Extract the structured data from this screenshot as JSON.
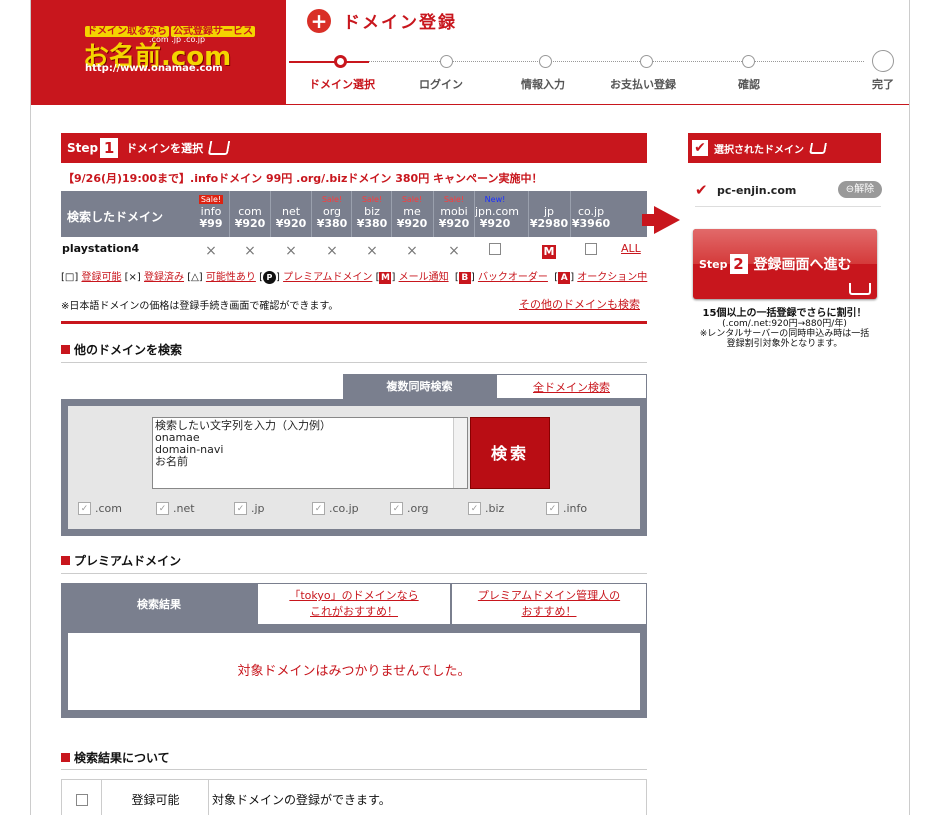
{
  "header": {
    "logo_tagline": "ドメイン取るなら",
    "logo_badge": "公式登録サービス",
    "logo_tlds": ".com .jp .co.jp",
    "logo_name": "お名前.com",
    "logo_url": "http://www.onamae.com",
    "page_title": "ドメイン登録",
    "steps": [
      "ドメイン選択",
      "ログイン",
      "情報入力",
      "お支払い登録",
      "確認",
      "完了"
    ],
    "current_step": 0
  },
  "step1": {
    "step_word": "Step",
    "step_num": "1",
    "title": "ドメインを選択",
    "campaign": "【9/26(月)19:00まで】.infoドメイン 99円 .org/.bizドメイン 380円 キャンペーン実施中！"
  },
  "domain_table": {
    "header_label": "検索したドメイン",
    "columns": [
      {
        "badge": "Sale!",
        "badge_type": "salebox",
        "tld": "info",
        "price": "¥99"
      },
      {
        "badge": "",
        "badge_type": "",
        "tld": "com",
        "price": "¥920"
      },
      {
        "badge": "",
        "badge_type": "",
        "tld": "net",
        "price": "¥920"
      },
      {
        "badge": "Sale!",
        "badge_type": "sale",
        "tld": "org",
        "price": "¥380"
      },
      {
        "badge": "Sale!",
        "badge_type": "sale",
        "tld": "biz",
        "price": "¥380"
      },
      {
        "badge": "Sale!",
        "badge_type": "sale",
        "tld": "me",
        "price": "¥920"
      },
      {
        "badge": "Sale!",
        "badge_type": "sale",
        "tld": "mobi",
        "price": "¥920"
      },
      {
        "badge": "New!",
        "badge_type": "new",
        "tld": "jpn.com",
        "price": "¥920"
      },
      {
        "badge": "",
        "badge_type": "",
        "tld": "jp",
        "price": "¥2980"
      },
      {
        "badge": "",
        "badge_type": "",
        "tld": "co.jp",
        "price": "¥3960"
      }
    ],
    "query": "playstation4",
    "status": [
      "×",
      "×",
      "×",
      "×",
      "×",
      "×",
      "×",
      "□",
      "M",
      "□"
    ],
    "all_link": "ALL"
  },
  "legend": {
    "available_sym": "[□]",
    "available": "登録可能",
    "taken_sym": "[×]",
    "taken": "登録済み",
    "maybe_sym": "[△]",
    "maybe": "可能性あり",
    "premium_sym": "P",
    "premium": "プレミアムドメイン",
    "mail_sym": "M",
    "mail": "メール通知",
    "backorder_sym": "B",
    "backorder": "バックオーダー",
    "auction_sym": "A",
    "auction": "オークション中"
  },
  "note": "※日本語ドメインの価格は登録手続き画面で確認ができます。",
  "other_search_link": "その他のドメインも検索",
  "other_search": {
    "title": "他のドメインを検索",
    "tab_active": "複数同時検索",
    "tab_inactive": "全ドメイン検索",
    "textarea": "検索したい文字列を入力（入力例）\nonamae\ndomain-navi\nお名前",
    "search_button": "検索",
    "tlds": [
      ".com",
      ".net",
      ".jp",
      ".co.jp",
      ".org",
      ".biz",
      ".info"
    ]
  },
  "premium": {
    "title": "プレミアムドメイン",
    "head1": "検索結果",
    "head2_line1": "「tokyo」のドメインなら",
    "head2_line2": "これがおすすめ！",
    "head3_line1": "プレミアムドメイン管理人の",
    "head3_line2": "おすすめ！",
    "empty": "対象ドメインはみつかりませんでした。"
  },
  "about": {
    "title": "検索結果について",
    "row_label": "登録可能",
    "row_desc": "対象ドメインの登録ができます。"
  },
  "sidebar": {
    "selected_title": "選択されたドメイン",
    "selected_domain": "pc-enjin.com",
    "remove_button": "解除",
    "step_word": "Step",
    "step_num": "2",
    "proceed_label": "登録画面へ進む",
    "promo_line1": "15個以上の一括登録でさらに割引！",
    "promo_line2": "(.com/.net:920円→880円/年)",
    "promo_line3": "※レンタルサーバーの同時申込み時は一括",
    "promo_line4": "登録割引対象外となります。"
  },
  "colors": {
    "brand_red": "#c8161d",
    "panel_gray": "#7a7f8e",
    "logo_yellow": "#f4d400"
  }
}
